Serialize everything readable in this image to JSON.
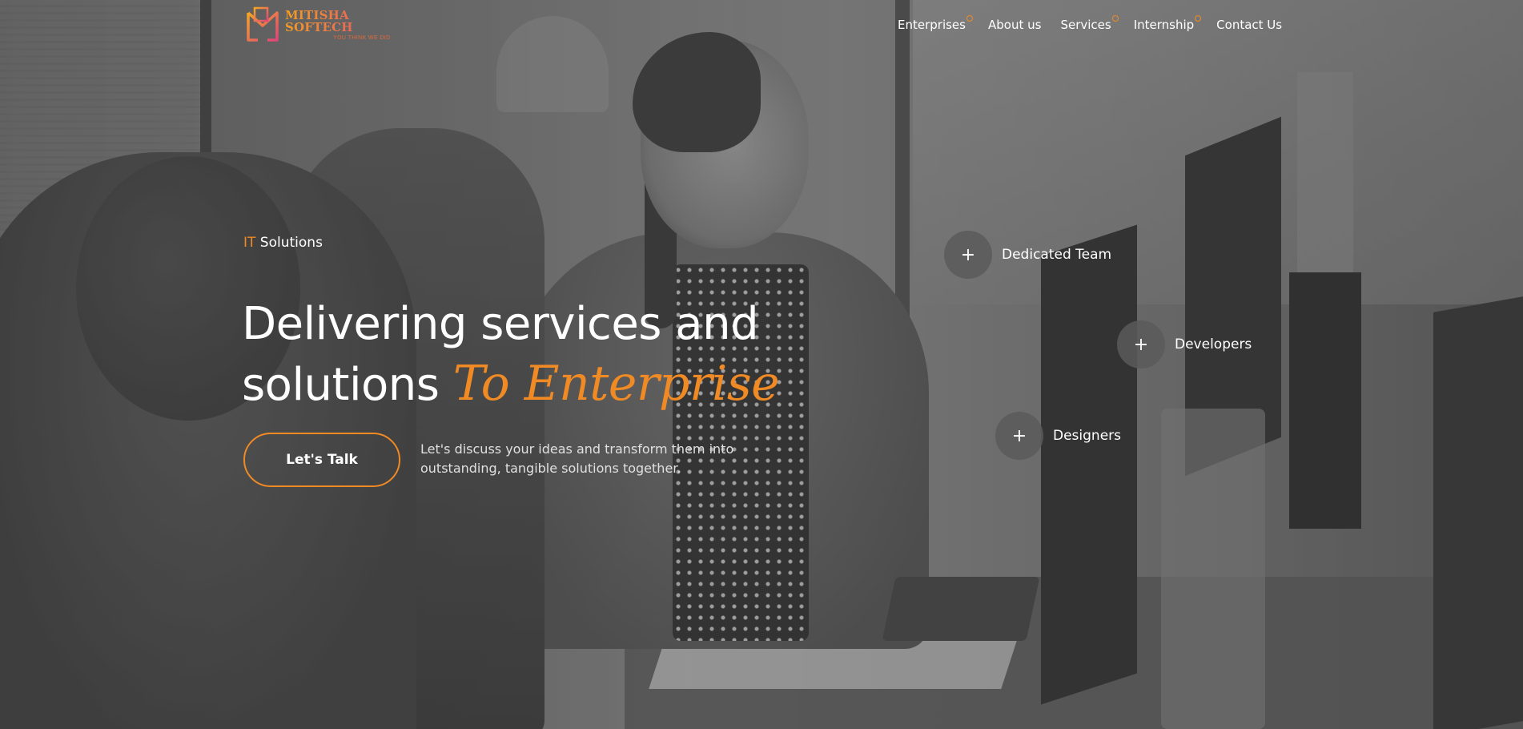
{
  "brand": {
    "name": "MITISHA SOFTECH",
    "tagline": "YOU THINK WE DID",
    "colors": {
      "accent": "#f08a24",
      "accent_secondary": "#e0457a"
    }
  },
  "nav": {
    "items": [
      {
        "label": "Enterprises",
        "has_indicator": true
      },
      {
        "label": "About us",
        "has_indicator": false
      },
      {
        "label": "Services",
        "has_indicator": true
      },
      {
        "label": "Internship",
        "has_indicator": true
      },
      {
        "label": "Contact Us",
        "has_indicator": false
      }
    ]
  },
  "hero": {
    "eyebrow_accent": "IT",
    "eyebrow_rest": " Solutions",
    "headline_line1": "Delivering services and",
    "headline_line2": "solutions ",
    "headline_script": "To Enterprise",
    "cta_label": "Let's Talk",
    "subtext": "Let's discuss your ideas and transform them into outstanding, tangible solutions together."
  },
  "features": [
    {
      "label": "Dedicated Team",
      "icon": "plus-icon"
    },
    {
      "label": "Developers",
      "icon": "plus-icon"
    },
    {
      "label": "Designers",
      "icon": "plus-icon"
    }
  ]
}
